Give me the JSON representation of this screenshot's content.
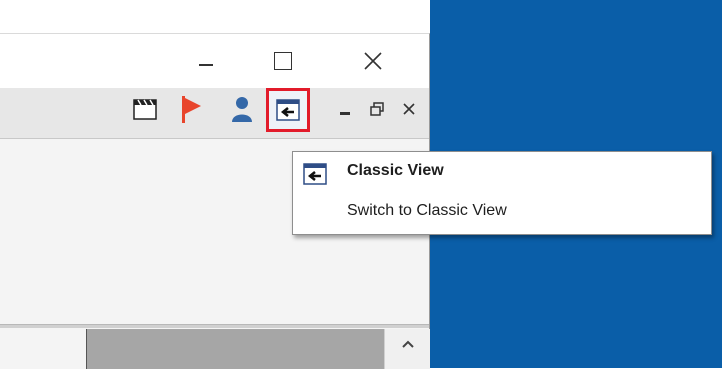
{
  "colors": {
    "desktop": "#0a5ea8",
    "highlight": "#e21b2a",
    "flag": "#e8452c",
    "user": "#3468a8"
  },
  "toolbar": {
    "icons": [
      "movie-clapboard-icon",
      "flag-icon",
      "user-icon",
      "classic-view-icon",
      "minimize-icon",
      "restore-icon",
      "close-icon"
    ]
  },
  "tooltip": {
    "title": "Classic View",
    "description": "Switch to Classic View"
  }
}
